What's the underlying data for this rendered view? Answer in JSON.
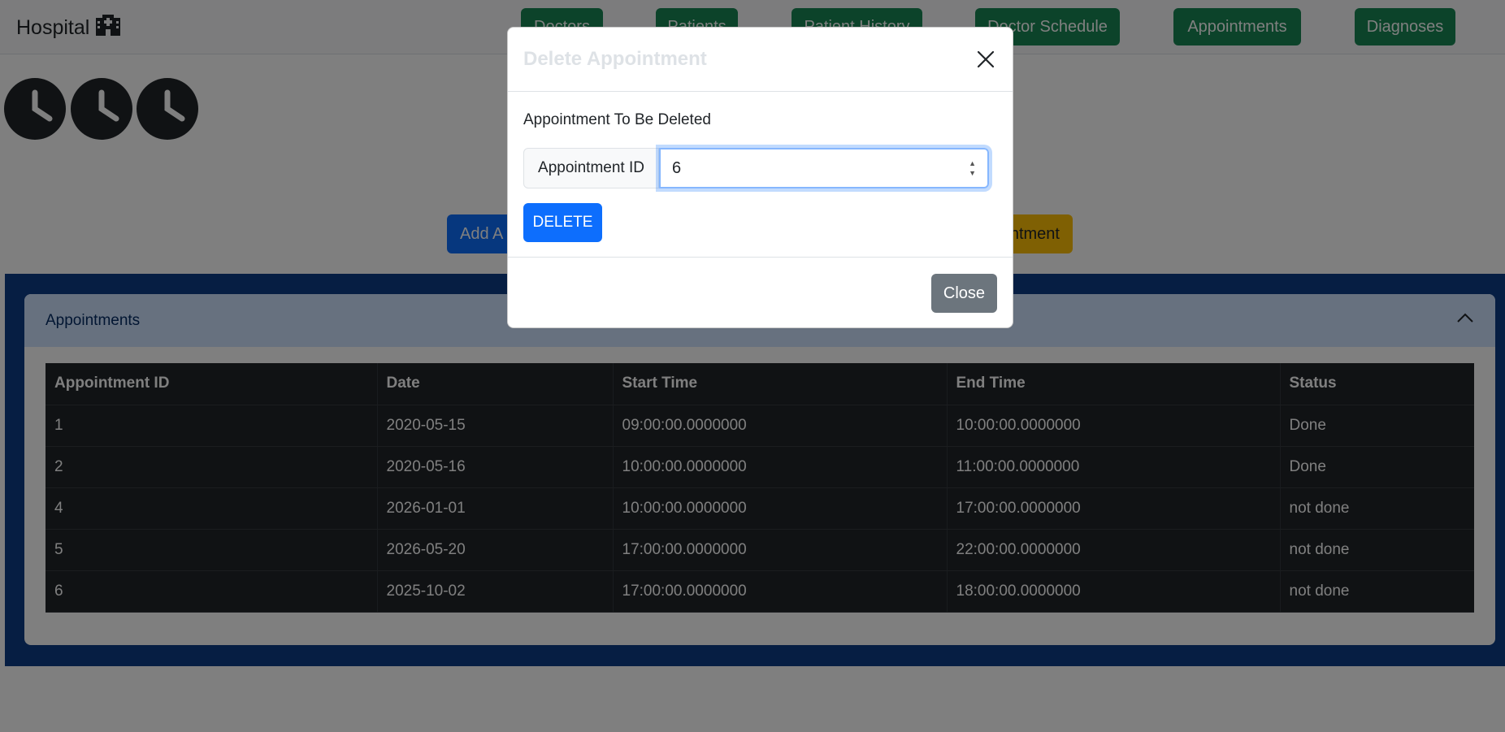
{
  "app": {
    "brand": "Hospital",
    "brand_icon": "hospital-icon"
  },
  "nav": {
    "items": [
      {
        "label": "Doctors"
      },
      {
        "label": "Patients"
      },
      {
        "label": "Patient History"
      },
      {
        "label": "Doctor Schedule"
      },
      {
        "label": "Appointments"
      },
      {
        "label": "Diagnoses"
      }
    ]
  },
  "actions": {
    "add_label": "Add A",
    "yellow_label": "ntment"
  },
  "card": {
    "title": "Appointments",
    "toggle_icon": "chevron-up-icon"
  },
  "table": {
    "headers": [
      "Appointment ID",
      "Date",
      "Start Time",
      "End Time",
      "Status"
    ],
    "rows": [
      [
        "1",
        "2020-05-15",
        "09:00:00.0000000",
        "10:00:00.0000000",
        "Done"
      ],
      [
        "2",
        "2020-05-16",
        "10:00:00.0000000",
        "11:00:00.0000000",
        "Done"
      ],
      [
        "4",
        "2026-01-01",
        "10:00:00.0000000",
        "17:00:00.0000000",
        "not done"
      ],
      [
        "5",
        "2026-05-20",
        "17:00:00.0000000",
        "22:00:00.0000000",
        "not done"
      ],
      [
        "6",
        "2025-10-02",
        "17:00:00.0000000",
        "18:00:00.0000000",
        "not done"
      ]
    ]
  },
  "modal": {
    "title": "Delete Appointment",
    "body_label": "Appointment To Be Deleted",
    "input_addon": "Appointment ID",
    "input_value": "6",
    "delete_label": "DELETE",
    "close_label": "Close"
  },
  "colors": {
    "nav_button": "#198754",
    "primary": "#0d6efd",
    "warning": "#ffc107",
    "section_bg": "#0d3c86",
    "card_header": "#cfe2ff",
    "table_dark": "#212529",
    "secondary": "#6c757d"
  }
}
